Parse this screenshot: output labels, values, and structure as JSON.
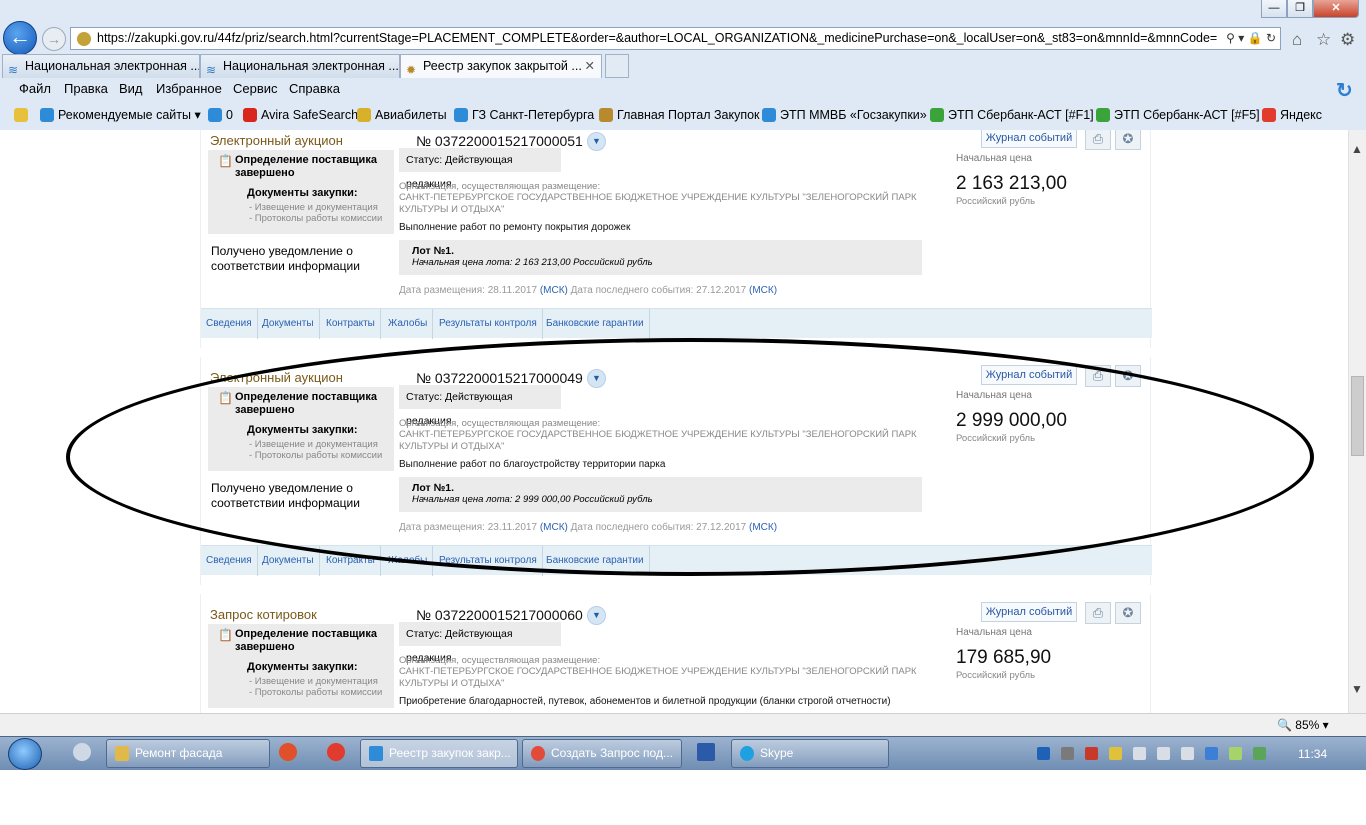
{
  "window": {
    "url": "https://zakupki.gov.ru/44fz/priz/search.html?currentStage=PLACEMENT_COMPLETE&order=&author=LOCAL_ORGANIZATION&_medicinePurchase=on&_localUser=on&_st83=on&mnnId=&mnnCode=",
    "tabs": [
      {
        "label": "Национальная электронная ..."
      },
      {
        "label": "Национальная электронная ..."
      },
      {
        "label": "Реестр закупок закрытой ..."
      }
    ],
    "menu": [
      "Файл",
      "Правка",
      "Вид",
      "Избранное",
      "Сервис",
      "Справка"
    ],
    "favorites": [
      {
        "label": "Рекомендуемые сайты ▾",
        "color": "#2d8bd8"
      },
      {
        "label": "0",
        "color": "#2d8bd8"
      },
      {
        "label": "Avira SafeSearch",
        "color": "#d9261c"
      },
      {
        "label": "Авиабилеты",
        "color": "#d8b12a"
      },
      {
        "label": "ГЗ Санкт-Петербурга",
        "color": "#2d8bd8"
      },
      {
        "label": "Главная Портал Закупок",
        "color": "#b88a2e"
      },
      {
        "label": "ЭТП ММВБ «Госзакупки»",
        "color": "#2d8bd8"
      },
      {
        "label": "ЭТП Сбербанк-АСТ [#F1]",
        "color": "#3aa33a"
      },
      {
        "label": "ЭТП Сбербанк-АСТ [#F5]",
        "color": "#3aa33a"
      },
      {
        "label": "Яндекс",
        "color": "#e03b2c"
      }
    ]
  },
  "card_ui": {
    "journal_label": "Журнал событий",
    "stage_text": "Определение поставщика завершено",
    "docs_title": "Документы закупки:",
    "doc_links": [
      "- Извещение и документация",
      "- Протоколы работы комиссии"
    ],
    "notify_text": "Получено уведомление о соответствии информации",
    "status": "Статус: Действующая редакция",
    "org_label": "Организация, осуществляющая размещение:",
    "org_name": "САНКТ-ПЕТЕРБУРГСКОЕ ГОСУДАРСТВЕННОЕ БЮДЖЕТНОЕ УЧРЕЖДЕНИЕ КУЛЬТУРЫ \"ЗЕЛЕНОГОРСКИЙ ПАРК КУЛЬТУРЫ И ОТДЫХА\"",
    "lot_title": "Лот №1.",
    "price_label": "Начальная цена",
    "currency": "Российский рубль",
    "date_posted_label": "Дата размещения:",
    "date_last_label": "Дата последнего события:",
    "tz": "(МСК)",
    "tabs": [
      "Сведения",
      "Документы",
      "Контракты",
      "Жалобы",
      "Результаты контроля",
      "Банковские гарантии"
    ]
  },
  "cards": [
    {
      "type": "Электронный аукцион",
      "number": "№ 0372200015217000051",
      "subject": "Выполнение работ по ремонту покрытия дорожек",
      "lot_price": "Начальная цена лота: 2 163 213,00 Российский рубль",
      "date_posted": "28.11.2017",
      "date_last": "27.12.2017",
      "price": "2 163 213,00"
    },
    {
      "type": "Электронный аукцион",
      "number": "№ 0372200015217000049",
      "subject": "Выполнение работ по благоустройству территории парка",
      "lot_price": "Начальная цена лота: 2 999 000,00 Российский рубль",
      "date_posted": "23.11.2017",
      "date_last": "27.12.2017",
      "price": "2 999 000,00"
    },
    {
      "type": "Запрос котировок",
      "number": "№ 0372200015217000060",
      "subject": "Приобретение благодарностей, путевок, абонементов и билетной продукции (бланки строгой отчетности)",
      "price": "179 685,90"
    }
  ],
  "statusbar": {
    "zoom": "85% ▾"
  },
  "taskbar": {
    "apps": [
      {
        "label": "Ремонт фасада",
        "color": "#e0b94a"
      },
      {
        "label": "Реестр закупок закр...",
        "color": "#2d8bd8"
      },
      {
        "label": "Создать Запрос под...",
        "color": "#e24a3a"
      },
      {
        "label": "Skype",
        "color": "#1ea1e0"
      }
    ],
    "clock": "11:34"
  }
}
